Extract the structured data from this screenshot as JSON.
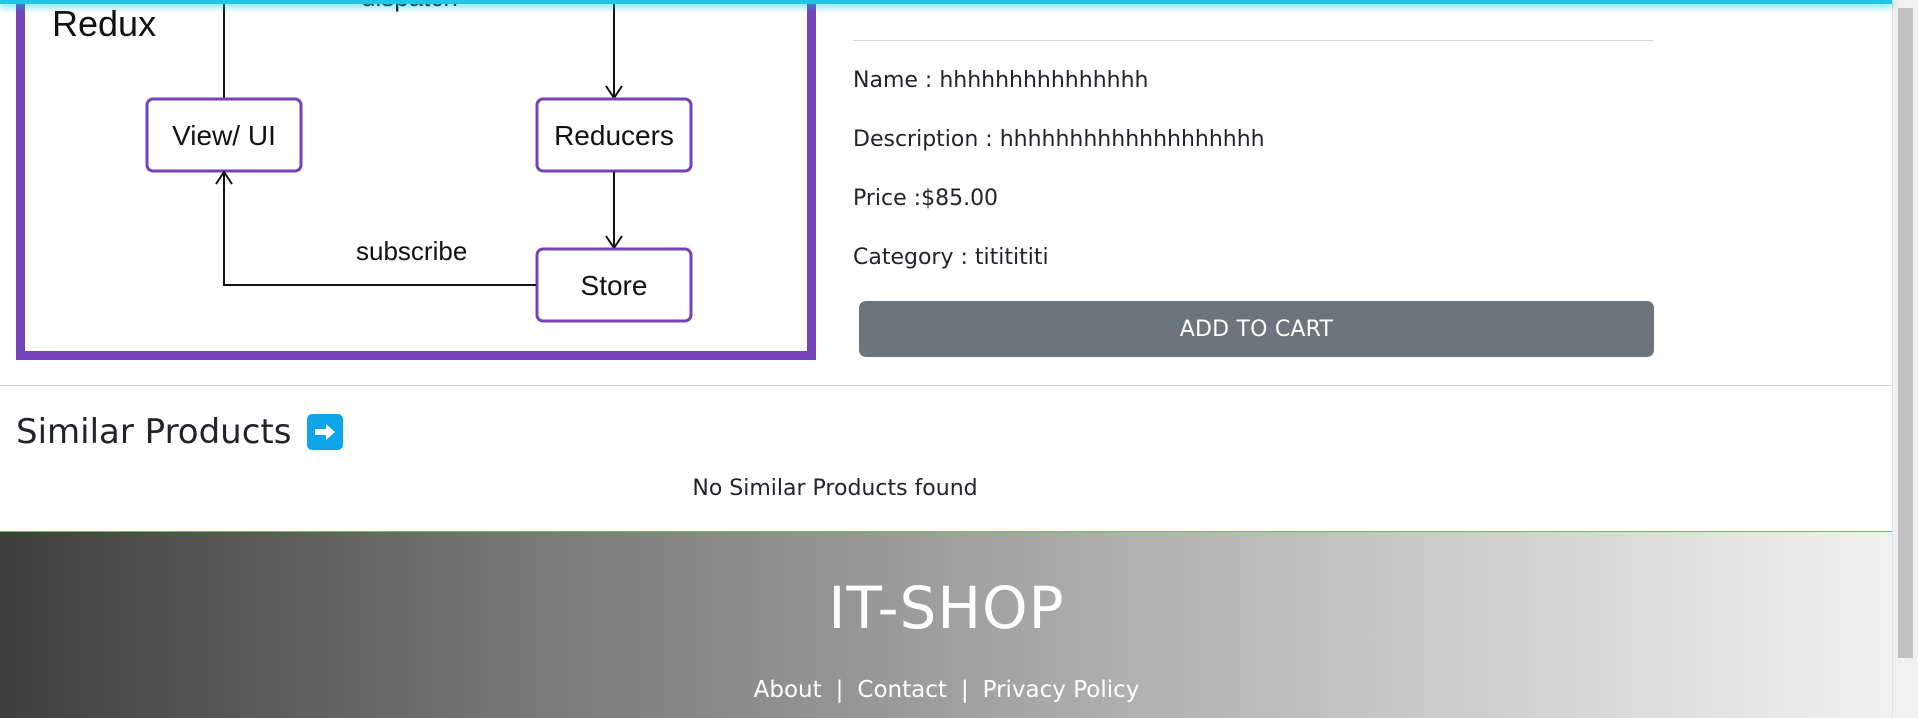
{
  "product": {
    "image": {
      "title": "Redux",
      "nodes": {
        "view": "View/ UI",
        "reducers": "Reducers",
        "store": "Store"
      },
      "edges": {
        "dispatch": "dispatch",
        "subscribe": "subscribe"
      },
      "border_color": "#7443b8"
    },
    "details": {
      "name_label": "Name : ",
      "name_value": "hhhhhhhhhhhhhhh",
      "description_label": "Description : ",
      "description_value": "hhhhhhhhhhhhhhhhhhh",
      "price_label": "Price :",
      "price_value": "$85.00",
      "category_label": "Category : ",
      "category_value": "tititititi"
    },
    "add_to_cart_label": "ADD TO CART"
  },
  "similar": {
    "title": "Similar Products",
    "arrow_icon": "right-arrow-icon",
    "empty_message": "No Similar Products found"
  },
  "footer": {
    "brand": "IT-SHOP",
    "links": [
      "About",
      "Contact",
      "Privacy Policy"
    ],
    "separator": "|"
  },
  "colors": {
    "accent_cyan": "#22c5e6",
    "button_gray": "#6c757d",
    "arrow_blue": "#10a4e8"
  }
}
